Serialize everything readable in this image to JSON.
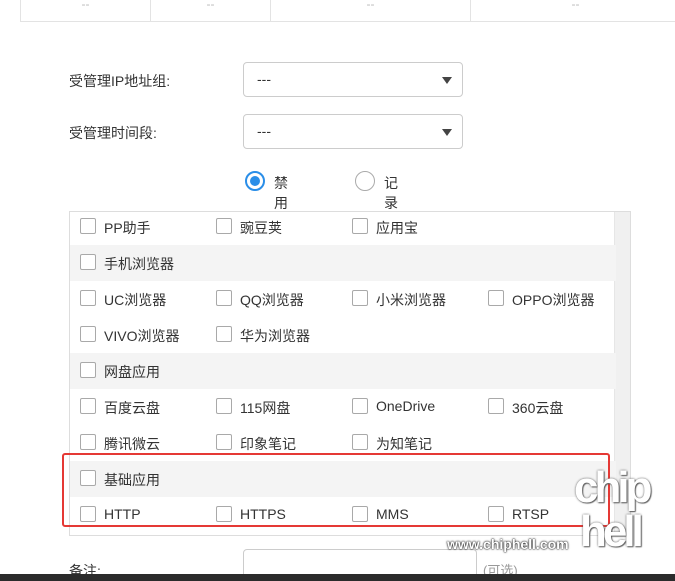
{
  "top_table": {
    "cells": [
      "--",
      "--",
      "--",
      "--"
    ]
  },
  "form": {
    "ip_group_label": "受管理IP地址组:",
    "ip_group_value": "---",
    "time_label": "受管理时间段:",
    "time_value": "---"
  },
  "mode": {
    "options": [
      {
        "label": "禁用列表",
        "checked": true
      },
      {
        "label": "记录列表",
        "checked": false
      }
    ]
  },
  "app_list": {
    "rows": [
      {
        "group": false,
        "items": [
          "PP助手",
          "豌豆荚",
          "应用宝"
        ]
      },
      {
        "group": true,
        "items": [
          "手机浏览器"
        ]
      },
      {
        "group": false,
        "items": [
          "UC浏览器",
          "QQ浏览器",
          "小米浏览器",
          "OPPO浏览器"
        ]
      },
      {
        "group": false,
        "items": [
          "VIVO浏览器",
          "华为浏览器"
        ]
      },
      {
        "group": true,
        "items": [
          "网盘应用"
        ]
      },
      {
        "group": false,
        "items": [
          "百度云盘",
          "115网盘",
          "OneDrive",
          "360云盘"
        ]
      },
      {
        "group": false,
        "items": [
          "腾讯微云",
          "印象笔记",
          "为知笔记"
        ]
      },
      {
        "group": true,
        "items": [
          "基础应用"
        ]
      },
      {
        "group": false,
        "items": [
          "HTTP",
          "HTTPS",
          "MMS",
          "RTSP"
        ]
      }
    ]
  },
  "remark": {
    "label": "备注:",
    "optional": "(可选)"
  },
  "watermark": {
    "site": "www.chiphell.com",
    "logo_top": "chip",
    "logo_bottom": "hell"
  },
  "colors": {
    "accent": "#2a8ee8",
    "highlight": "#e53935"
  }
}
